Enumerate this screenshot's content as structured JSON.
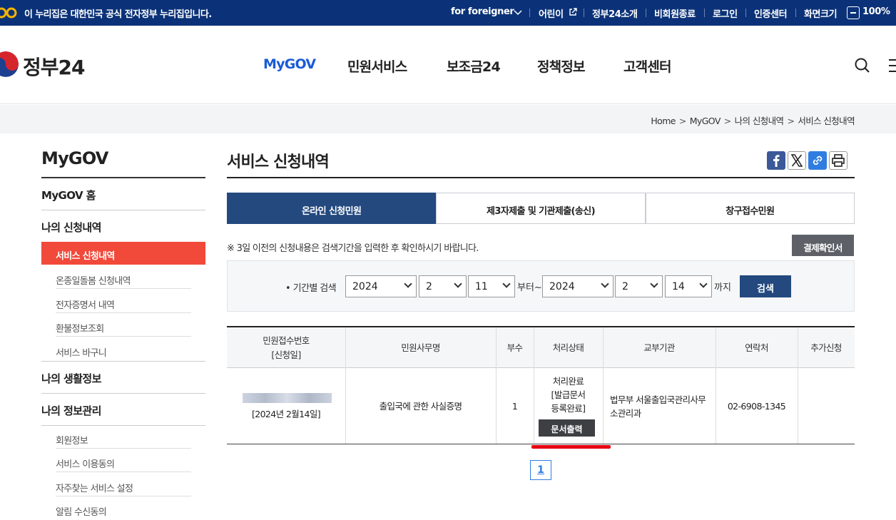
{
  "topbar": {
    "notice": "이 누리집은 대한민국 공식 전자정부 누리집입니다.",
    "foreigner": "for foreigner",
    "kids": "어린이",
    "about": "정부24소개",
    "logout_guest": "비회원종료",
    "login": "로그인",
    "cert": "인증센터",
    "screen_size": "화면크기",
    "zoom": "100%"
  },
  "header": {
    "brand": "정부24",
    "nav": [
      "MyGOV",
      "민원서비스",
      "보조금24",
      "정책정보",
      "고객센터"
    ],
    "active_nav": "MyGOV"
  },
  "breadcrumb": [
    "Home",
    "MyGOV",
    "나의 신청내역",
    "서비스 신청내역"
  ],
  "sidebar": {
    "title": "MyGOV",
    "home": "MyGOV 홈",
    "section1": "나의 신청내역",
    "items1": [
      "서비스 신청내역",
      "온종일돌봄 신청내역",
      "전자증명서 내역",
      "환불정보조회",
      "서비스 바구니"
    ],
    "section2": "나의 생활정보",
    "section3": "나의 정보관리",
    "items3": [
      "회원정보",
      "서비스 이용동의",
      "자주찾는 서비스 설정",
      "알림 수신동의"
    ]
  },
  "main": {
    "title": "서비스 신청내역",
    "tabs": [
      "온라인 신청민원",
      "제3자제출 및 기관제출(송신)",
      "창구접수민원"
    ],
    "notice": "※ 3일 이전의 신청내용은 검색기간을 입력한 후 확인하시기 바랍니다.",
    "confirm_button": "결제확인서",
    "search": {
      "label": "• 기간별 검색",
      "from_year": "2024",
      "from_month": "2",
      "from_day": "11",
      "from_text": "부터~",
      "to_year": "2024",
      "to_month": "2",
      "to_day": "14",
      "to_text": "까지",
      "button": "검색"
    },
    "table": {
      "headers": [
        "민원접수번호\n[신청일]",
        "민원사무명",
        "부수",
        "처리상태",
        "교부기관",
        "연락처",
        "추가신청"
      ],
      "row": {
        "date": "[2024년 2월14일]",
        "name": "출입국에 관한 사실증명",
        "copies": "1",
        "status": "처리완료\n[발급문서\n등록완료]",
        "print_button": "문서출력",
        "agency": "법무부 서울출입국관리사무소관리과",
        "contact": "02-6908-1345",
        "extra": ""
      }
    },
    "page": "1"
  },
  "colors": {
    "topbar": "#0b3278",
    "accent": "#1a5bd6",
    "active_side": "#f1493a",
    "tab_active": "#23497f"
  }
}
